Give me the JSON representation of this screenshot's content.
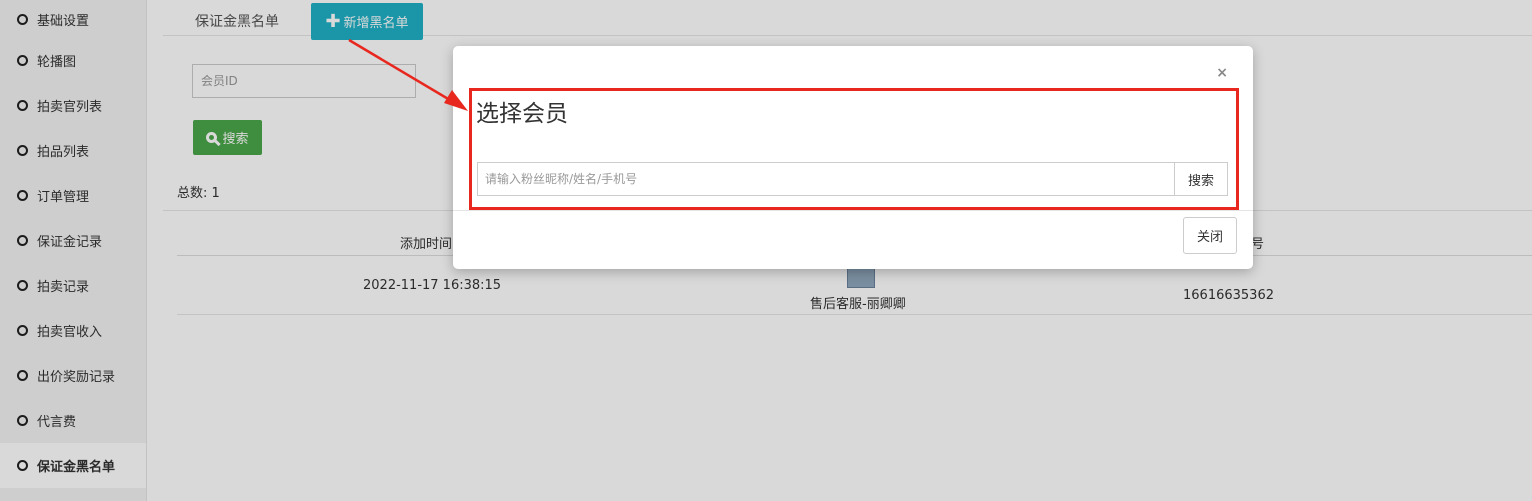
{
  "sidebar": {
    "items": [
      {
        "label": "基础设置"
      },
      {
        "label": "轮播图"
      },
      {
        "label": "拍卖官列表"
      },
      {
        "label": "拍品列表"
      },
      {
        "label": "订单管理"
      },
      {
        "label": "保证金记录"
      },
      {
        "label": "拍卖记录"
      },
      {
        "label": "拍卖官收入"
      },
      {
        "label": "出价奖励记录"
      },
      {
        "label": "代言费"
      },
      {
        "label": "保证金黑名单"
      }
    ],
    "active_item": "保证金黑名单"
  },
  "main": {
    "tab_title": "保证金黑名单",
    "add_button": "新增黑名单",
    "member_id_placeholder": "会员ID",
    "search_button": "搜索",
    "total_label": "总数: ",
    "total_value": "1",
    "table": {
      "visible_headers": [
        "添加时间",
        "号"
      ],
      "rows": [
        {
          "time": "2022-11-17 16:38:15",
          "member": "售后客服-丽卿卿",
          "phone": "16616635362"
        }
      ]
    }
  },
  "modal": {
    "close_symbol": "×",
    "title": "选择会员",
    "search_placeholder": "请输入粉丝昵称/姓名/手机号",
    "search_button": "搜索",
    "close_button": "关闭"
  },
  "colors": {
    "add_button": "#1fb1c6",
    "search_button": "#4aa74a",
    "annotation": "#e8271e"
  }
}
